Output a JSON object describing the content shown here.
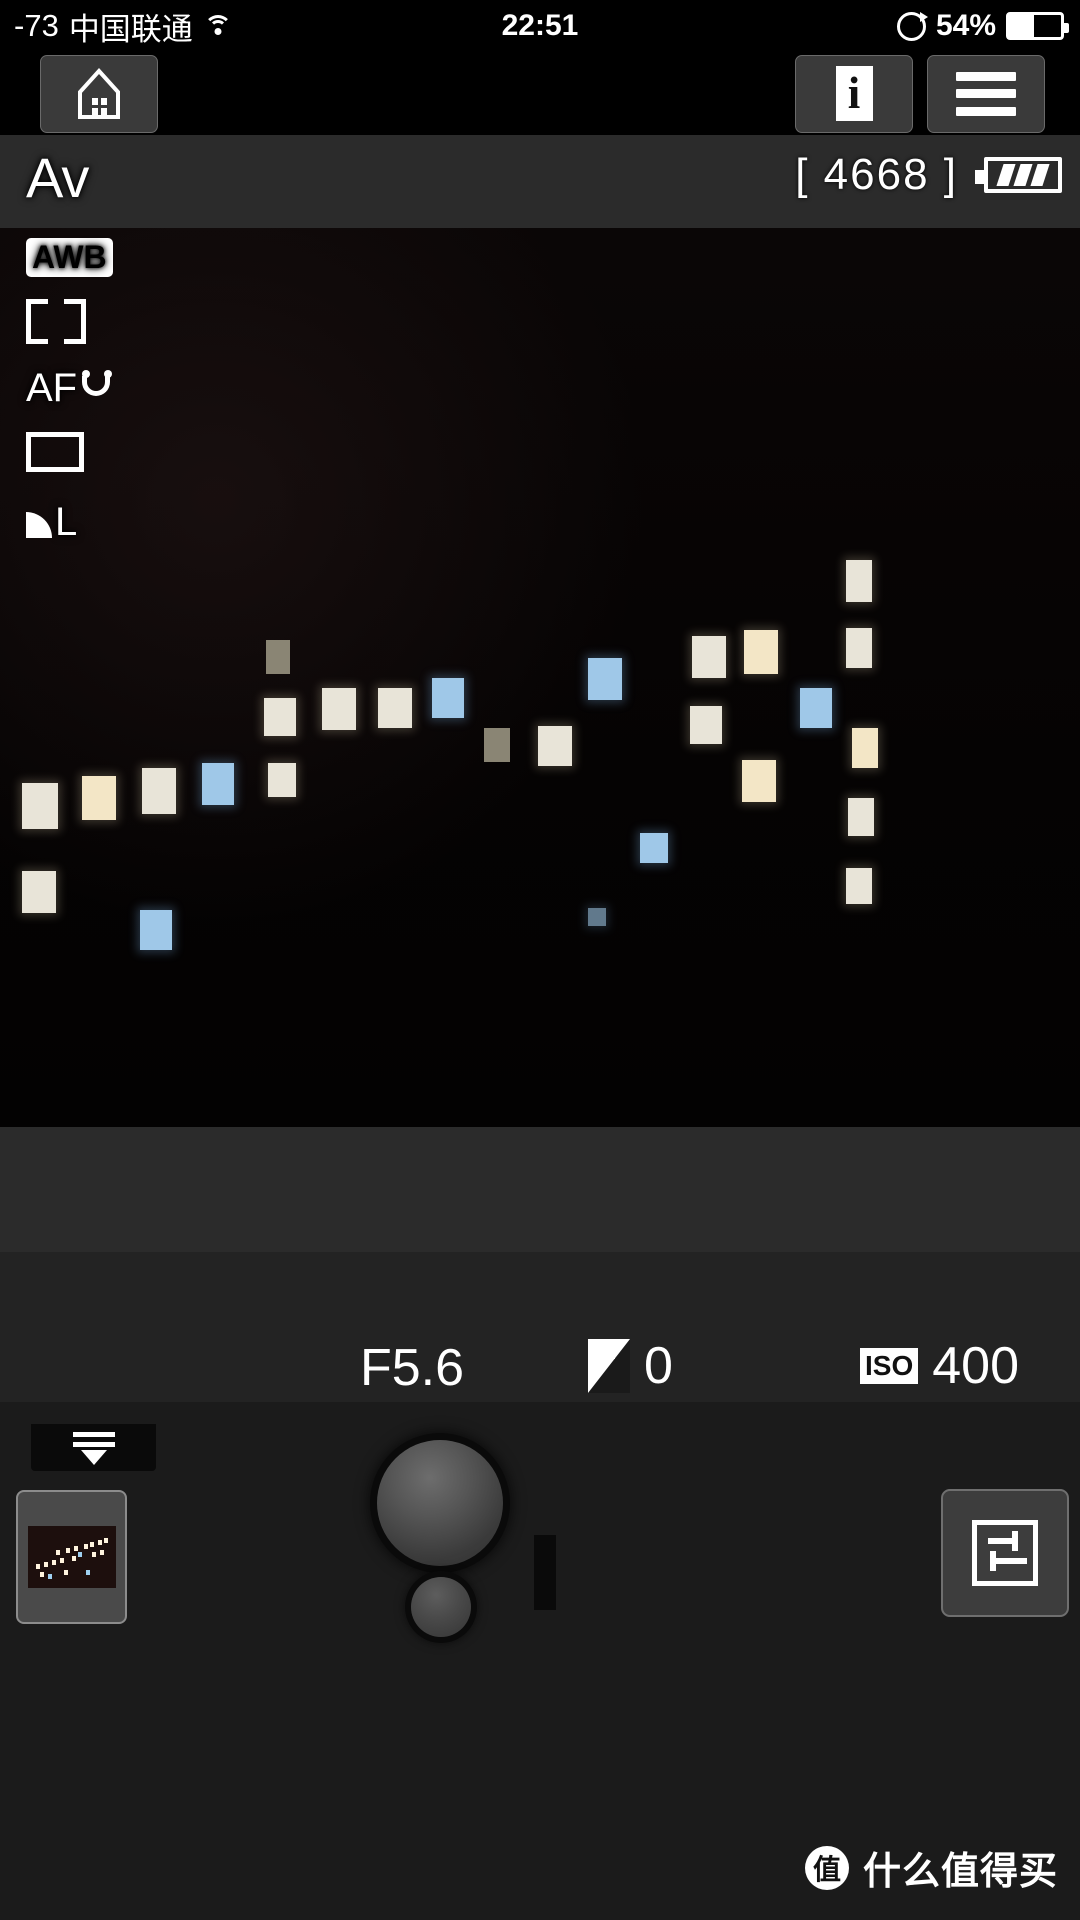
{
  "status_bar": {
    "signal_strength": "-73",
    "carrier": "中国联通",
    "wifi_icon": "wifi-icon",
    "time": "22:51",
    "rotation_lock_icon": "rotation-lock-icon",
    "battery_percent": "54%",
    "battery_icon": "battery-icon"
  },
  "toolbar": {
    "home_icon": "home-icon",
    "info_label": "i",
    "info_icon": "info-icon",
    "menu_icon": "hamburger-menu-icon"
  },
  "viewfinder": {
    "shooting_mode": "Av",
    "white_balance": "AWB",
    "metering_icon": "partial-metering-icon",
    "af_label": "AF",
    "af_mode_icon": "face-tracking-icon",
    "drive_mode_icon": "single-shot-icon",
    "quality_icon": "fine-quality-icon",
    "quality_size": "L",
    "shots_remaining": "[ 4668 ]",
    "camera_battery_icon": "camera-battery-full-icon"
  },
  "exposure": {
    "aperture": "F5.6",
    "exposure_comp_icon": "exposure-compensation-icon",
    "exposure_comp_value": "0",
    "iso_label": "ISO",
    "iso_value": "400"
  },
  "controls": {
    "drawer_tab_icon": "drawer-pull-down-icon",
    "thumbnail_name": "last-photo-thumbnail",
    "shutter_icon": "shutter-button",
    "half_press_icon": "half-press-button",
    "settings_icon": "settings-sliders-icon"
  },
  "watermark": {
    "logo_char": "值",
    "text": "什么值得买"
  },
  "colors": {
    "background": "#000000",
    "panel": "#2b2b2b",
    "deck": "#1b1b1b",
    "button_face": "#3d3d3d",
    "button_border": "#6f6f6f",
    "text": "#ffffff"
  }
}
